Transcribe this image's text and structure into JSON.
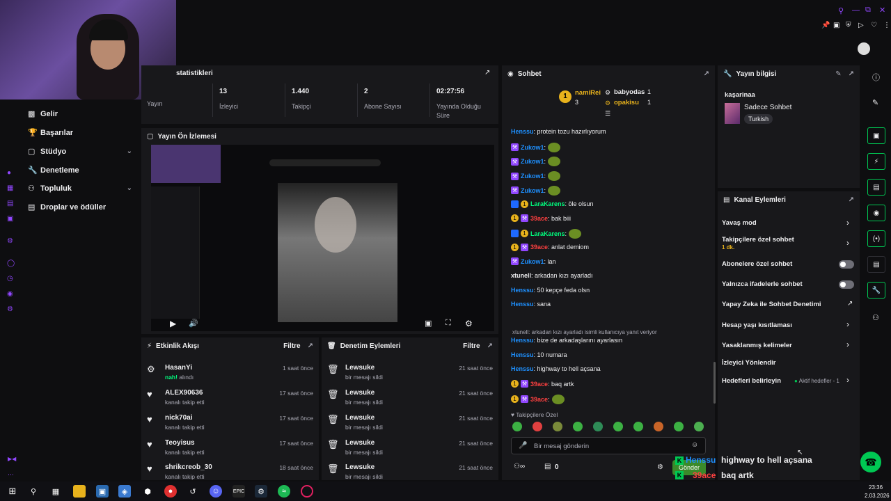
{
  "sidebar": {
    "items": [
      {
        "label": "Gelir",
        "icon": "bar-chart-icon"
      },
      {
        "label": "Başarılar",
        "icon": "trophy-icon"
      },
      {
        "label": "Stüdyo",
        "icon": "video-icon"
      },
      {
        "label": "Denetleme",
        "icon": "wrench-icon"
      },
      {
        "label": "Topluluk",
        "icon": "people-icon"
      },
      {
        "label": "Droplar ve ödüller",
        "icon": "gift-icon"
      }
    ]
  },
  "stats": {
    "title": "statistikleri",
    "items": [
      {
        "value": "",
        "label": "Yayın"
      },
      {
        "value": "13",
        "label": "İzleyici"
      },
      {
        "value": "1.440",
        "label": "Takipçi"
      },
      {
        "value": "2",
        "label": "Abone Sayısı"
      },
      {
        "value": "02:27:56",
        "label": "Yayında Olduğu Süre"
      }
    ]
  },
  "preview": {
    "title": "Yayın Ön İzlemesi"
  },
  "activity": {
    "title": "Etkinlik Akışı",
    "filter": "Filtre",
    "rows": [
      {
        "name": "HasanYi",
        "sub_hl": "nah!",
        "sub": "alındı",
        "time": "1 saat önce",
        "icon": "bits-icon"
      },
      {
        "name": "ALEX90636",
        "sub": "kanalı takip etti",
        "time": "17 saat önce",
        "icon": "heart-icon"
      },
      {
        "name": "nick70ai",
        "sub": "kanalı takip etti",
        "time": "17 saat önce",
        "icon": "heart-icon"
      },
      {
        "name": "Teoyisus",
        "sub": "kanalı takip etti",
        "time": "17 saat önce",
        "icon": "heart-icon"
      },
      {
        "name": "shrikcreob_30",
        "sub": "kanalı takip etti",
        "time": "18 saat önce",
        "icon": "heart-icon"
      }
    ]
  },
  "modlog": {
    "title": "Denetim Eylemleri",
    "filter": "Filtre",
    "rows": [
      {
        "name": "Lewsuke",
        "sub": "bir mesajı sildi",
        "time": "21 saat önce"
      },
      {
        "name": "Lewsuke",
        "sub": "bir mesajı sildi",
        "time": "21 saat önce"
      },
      {
        "name": "Lewsuke",
        "sub": "bir mesajı sildi",
        "time": "21 saat önce"
      },
      {
        "name": "Lewsuke",
        "sub": "bir mesajı sildi",
        "time": "21 saat önce"
      },
      {
        "name": "Lewsuke",
        "sub": "bir mesajı sildi",
        "time": "21 saat önce"
      }
    ]
  },
  "chat": {
    "title": "Sohbet",
    "leaders": [
      {
        "name": "namiRei",
        "count": "3"
      },
      {
        "name": "babyodas",
        "count": "1"
      },
      {
        "name": "opakisu",
        "count": "1"
      }
    ],
    "messages": [
      {
        "user": "Henssu",
        "color": "#1e90ff",
        "text": ": protein tozu hazırlıyorum",
        "badges": [],
        "emote": false
      },
      {
        "user": "Zukow1",
        "color": "#1e90ff",
        "text": ":",
        "badges": [
          "purple"
        ],
        "emote": true
      },
      {
        "user": "Zukow1",
        "color": "#1e90ff",
        "text": ":",
        "badges": [
          "purple"
        ],
        "emote": true
      },
      {
        "user": "Zukow1",
        "color": "#1e90ff",
        "text": ":",
        "badges": [
          "purple"
        ],
        "emote": true
      },
      {
        "user": "Zukow1",
        "color": "#1e90ff",
        "text": ":",
        "badges": [
          "purple"
        ],
        "emote": true
      },
      {
        "user": "LaraKarens",
        "color": "#00ff7f",
        "text": ": öle olsun",
        "badges": [
          "blue",
          "gold"
        ],
        "emote": false
      },
      {
        "user": "39ace",
        "color": "#ff4040",
        "text": ": bak biii",
        "badges": [
          "gold",
          "purple"
        ],
        "emote": false
      },
      {
        "user": "LaraKarens",
        "color": "#00ff7f",
        "text": ":",
        "badges": [
          "blue",
          "gold"
        ],
        "emote": true
      },
      {
        "user": "39ace",
        "color": "#ff4040",
        "text": ": anlat demiom",
        "badges": [
          "gold",
          "purple"
        ],
        "emote": false
      },
      {
        "user": "Zukow1",
        "color": "#1e90ff",
        "text": ": lan",
        "badges": [
          "purple"
        ],
        "emote": false
      },
      {
        "user": "xtunell",
        "color": "#efeff1",
        "text": ": arkadan kızı ayarladı",
        "badges": [],
        "emote": false
      },
      {
        "user": "Henssu",
        "color": "#1e90ff",
        "text": ": 50 kepçe feda olsn",
        "badges": [],
        "emote": false
      },
      {
        "user": "Henssu",
        "color": "#1e90ff",
        "text": ": sana",
        "badges": [],
        "emote": false
      }
    ],
    "reply_hint": "xtunell: arkadan kızı ayarladı isimli kullanıcıya yanıt veriyor",
    "messages2": [
      {
        "user": "Henssu",
        "color": "#1e90ff",
        "text": ": bize de arkadaşlarını ayarlasın",
        "badges": [],
        "emote": false
      },
      {
        "user": "Henssu",
        "color": "#1e90ff",
        "text": ": 10 numara",
        "badges": [],
        "emote": false
      },
      {
        "user": "Henssu",
        "color": "#1e90ff",
        "text": ": highway to hell açsana",
        "badges": [],
        "emote": false
      },
      {
        "user": "39ace",
        "color": "#ff4040",
        "text": ": baq artk",
        "badges": [
          "gold",
          "purple"
        ],
        "emote": false
      },
      {
        "user": "39ace",
        "color": "#ff4040",
        "text": ":",
        "badges": [
          "gold",
          "purple"
        ],
        "emote": true
      }
    ],
    "followers_only": "Takipçilere Özel",
    "input_placeholder": "Bir mesaj gönderin",
    "points": "0",
    "send": "Gönder"
  },
  "info": {
    "title": "Yayın bilgisi",
    "stream_title": "kaşarinaa",
    "category": "Sadece Sohbet",
    "tag": "Turkish"
  },
  "actions": {
    "title": "Kanal Eylemleri",
    "items": [
      {
        "label": "Yavaş mod",
        "sub": "",
        "control": "chevron"
      },
      {
        "label": "Takipçilere özel sohbet",
        "sub": "1 dk.",
        "control": "chevron"
      },
      {
        "label": "Abonelere özel sohbet",
        "sub": "",
        "control": "toggle"
      },
      {
        "label": "Yalnızca ifadelerle sohbet",
        "sub": "",
        "control": "toggle"
      },
      {
        "label": "Yapay Zeka ile Sohbet Denetimi",
        "sub": "",
        "control": "external"
      },
      {
        "label": "Hesap yaşı kısıtlaması",
        "sub": "",
        "control": "chevron"
      },
      {
        "label": "Yasaklanmış kelimeler",
        "sub": "",
        "control": "chevron"
      },
      {
        "label": "İzleyici Yönlendir",
        "sub": "",
        "control": "none"
      },
      {
        "label": "Hedefleri belirleyin",
        "sub": "",
        "control": "chevron",
        "extra": "Aktif hedefler - 1"
      }
    ]
  },
  "overlay": {
    "lines": [
      {
        "user": "Henssu",
        "text": "highway to hell açsana"
      },
      {
        "user": "39ace",
        "text": "baq artk"
      },
      {
        "user": "39ace",
        "text": ""
      }
    ]
  },
  "taskbar": {
    "time": "23:36",
    "date": "2.03.2026"
  },
  "colors": {
    "accent": "#9147ff",
    "green": "#00c853",
    "bg": "#0e0e10",
    "panel": "#18181b"
  }
}
